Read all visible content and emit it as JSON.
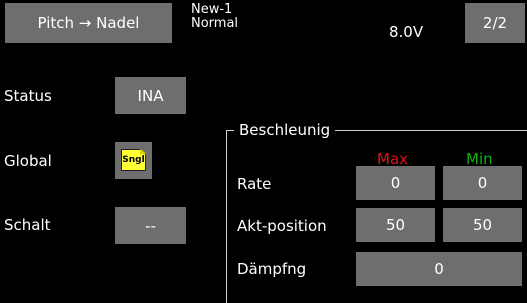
{
  "header": {
    "title": "Pitch → Nadel",
    "model_name": "New-1",
    "condition": "Normal",
    "voltage": "8.0V",
    "page": "2/2"
  },
  "rows": {
    "status": {
      "label": "Status",
      "value": "INA"
    },
    "global": {
      "label": "Global",
      "icon_text": "Sngl",
      "icon": "single-mode-icon",
      "icon_color": "#ffff33"
    },
    "schalt": {
      "label": "Schalt",
      "value": "--"
    }
  },
  "accel": {
    "title": "Beschleunig",
    "max_label": "Max",
    "min_label": "Min",
    "max_color": "#e01010",
    "min_color": "#10b010",
    "rate": {
      "label": "Rate",
      "max": "0",
      "min": "0"
    },
    "akt": {
      "label": "Akt-position",
      "max": "50",
      "min": "50"
    },
    "damp": {
      "label": "Dämpfng",
      "value": "0"
    }
  }
}
